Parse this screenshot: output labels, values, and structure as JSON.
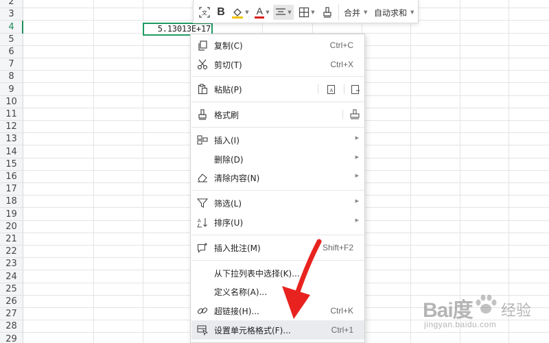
{
  "sheet": {
    "row_numbers": [
      "2",
      "3",
      "4",
      "5",
      "6",
      "7",
      "8",
      "9",
      "10",
      "11",
      "12",
      "13",
      "14",
      "15",
      "16",
      "17",
      "18",
      "19",
      "20",
      "21",
      "22",
      "23",
      "24",
      "25",
      "26",
      "27",
      "28",
      "29"
    ],
    "active_row": "4",
    "selected_cell_value": "5.13013E+17",
    "accent_color": "#1e9a63"
  },
  "toolbar": {
    "buttons": [
      "format-painter-ocr",
      "bold",
      "fill-color",
      "font-color",
      "align",
      "borders",
      "clear-format"
    ],
    "bold_label": "B",
    "font_color_label": "A",
    "merge_label": "合并",
    "autosum_label": "自动求和"
  },
  "menu": {
    "copy": {
      "label": "复制(C)",
      "shortcut": "Ctrl+C",
      "icon": "copy-icon"
    },
    "cut": {
      "label": "剪切(T)",
      "shortcut": "Ctrl+X",
      "icon": "scissors-icon"
    },
    "paste": {
      "label": "粘贴(P)",
      "icon": "clipboard-icon"
    },
    "format_painter": {
      "label": "格式刷",
      "icon": "brush-icon"
    },
    "insert": {
      "label": "插入(I)",
      "icon": "insert-icon"
    },
    "delete": {
      "label": "删除(D)"
    },
    "clear": {
      "label": "清除内容(N)",
      "icon": "eraser-icon"
    },
    "filter": {
      "label": "筛选(L)",
      "icon": "filter-icon"
    },
    "sort": {
      "label": "排序(U)",
      "icon": "sort-icon"
    },
    "insert_comment": {
      "label": "插入批注(M)",
      "shortcut": "Shift+F2",
      "icon": "comment-icon"
    },
    "pick_from_list": {
      "label": "从下拉列表中选择(K)..."
    },
    "define_name": {
      "label": "定义名称(A)..."
    },
    "hyperlink": {
      "label": "超链接(H)...",
      "shortcut": "Ctrl+K",
      "icon": "link-icon"
    },
    "format_cells": {
      "label": "设置单元格格式(F)...",
      "shortcut": "Ctrl+1",
      "icon": "format-cells-icon"
    }
  },
  "annotation": {
    "arrow_color": "#e8231f"
  },
  "watermark": {
    "logo": "Bai度",
    "site_name": "经验",
    "url": "jingyan.baidu.com"
  }
}
